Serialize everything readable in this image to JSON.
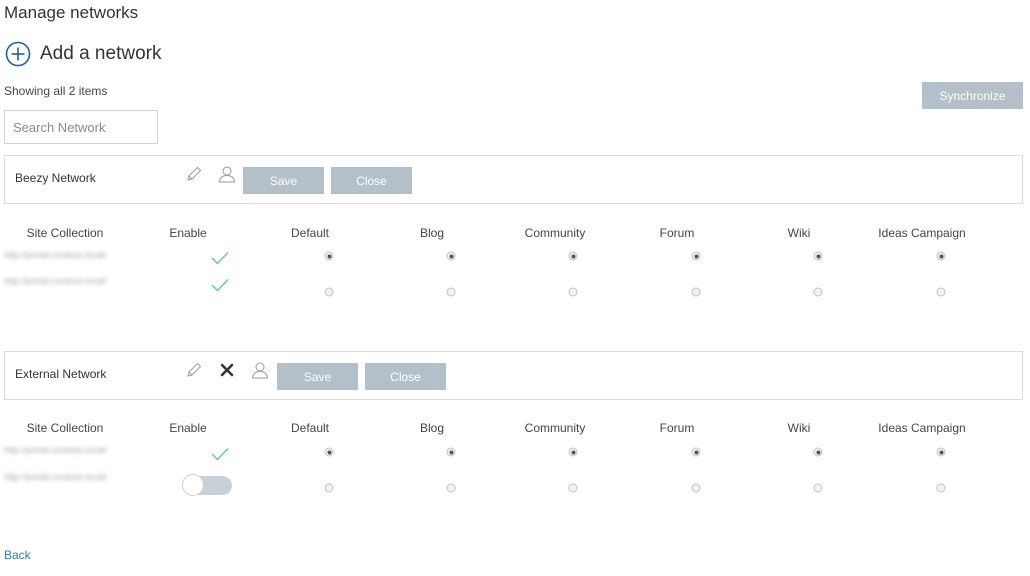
{
  "page": {
    "title": "Manage networks"
  },
  "toolbar": {
    "add_label": "Add a network",
    "showing_text": "Showing all 2 items",
    "synchronize_label": "Synchronize"
  },
  "search": {
    "placeholder": "Search Network",
    "value": ""
  },
  "columns": [
    "Site Collection",
    "Enable",
    "Default",
    "Blog",
    "Community",
    "Forum",
    "Wiki",
    "Ideas Campaign"
  ],
  "networks": [
    {
      "name": "Beezy Network",
      "save_label": "Save",
      "close_label": "Close",
      "icons": [
        "pencil-icon",
        "user-icon"
      ],
      "rows": [
        {
          "site": "http://portal.contoso.local/",
          "enabled": true,
          "state": "checkmark",
          "selected": [
            "Default",
            "Blog",
            "Community",
            "Forum",
            "Wiki",
            "Ideas Campaign"
          ]
        },
        {
          "site": "http://portal.contoso.local/",
          "enabled": true,
          "state": "checkmark",
          "selected": []
        }
      ]
    },
    {
      "name": "External Network",
      "save_label": "Save",
      "close_label": "Close",
      "icons": [
        "pencil-icon",
        "close-icon",
        "user-icon"
      ],
      "rows": [
        {
          "site": "http://portal.contoso.local/",
          "enabled": true,
          "state": "checkmark",
          "selected": [
            "Default",
            "Blog",
            "Community",
            "Forum",
            "Wiki",
            "Ideas Campaign"
          ]
        },
        {
          "site": "http://portal.contoso.local/",
          "enabled": false,
          "state": "toggle-off",
          "selected": []
        }
      ]
    }
  ],
  "footer": {
    "back_label": "Back"
  },
  "colors": {
    "accent": "#2f7ad0",
    "button_gray": "#b3bfc9",
    "check_green": "#5dcf8f"
  }
}
